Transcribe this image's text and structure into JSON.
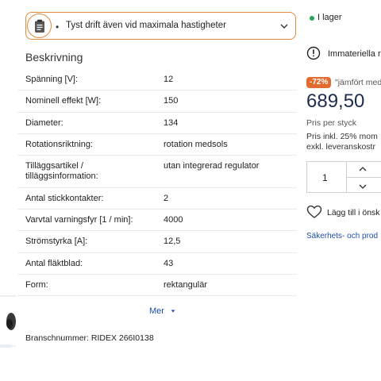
{
  "feature_dropdown": {
    "bullet": "•",
    "text": "Tyst drift även vid maximala hastigheter",
    "icon": "clipboard-icon"
  },
  "description": {
    "title": "Beskrivning",
    "rows": [
      {
        "label": "Spänning [V]:",
        "value": "12"
      },
      {
        "label": "Nominell effekt [W]:",
        "value": "150"
      },
      {
        "label": "Diameter:",
        "value": "134"
      },
      {
        "label": "Rotationsriktning:",
        "value": "rotation medsols"
      },
      {
        "label": "Tilläggsartikel / tilläggsinformation:",
        "value": "utan integrerad regulator"
      },
      {
        "label": "Antal stickkontakter:",
        "value": "2"
      },
      {
        "label": "Varvtal varningsfyr [1 / min]:",
        "value": "4000"
      },
      {
        "label": "Strömstyrka [A]:",
        "value": "12,5"
      },
      {
        "label": "Antal fläktblad:",
        "value": "43"
      },
      {
        "label": "Form:",
        "value": "rektangulär"
      }
    ],
    "more_label": "Mer",
    "branch_number": "Branschnummer: RIDEX 266I0138"
  },
  "purchase": {
    "stock": "I lager",
    "stock_color": "#2aa65a",
    "info": "Immateriella r",
    "discount": "-72%",
    "compare": "\"jämfört med",
    "price": "689,50",
    "price_unit": "Pris per styck",
    "tax_line1": "Pris inkl. 25% mom",
    "tax_line2": "exkl. leveranskostr",
    "quantity": "1",
    "wishlist": "Lägg till i önsk",
    "safety_link": "Säkerhets- och prod"
  },
  "colors": {
    "accent": "#e08a3c",
    "discount": "#e46b2f",
    "link": "#1f4fa8",
    "price": "#1b2c4f"
  }
}
